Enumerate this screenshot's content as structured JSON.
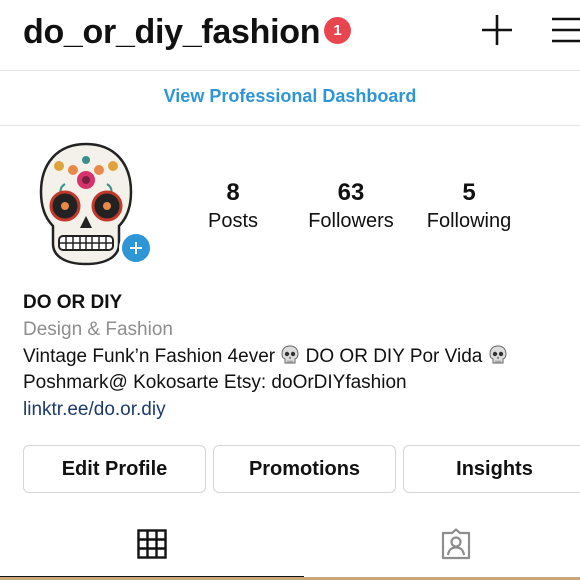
{
  "header": {
    "username": "do_or_diy_fashion",
    "notification_count": "1",
    "new_post_icon": "plus-icon",
    "menu_icon": "hamburger-menu-icon"
  },
  "professional_dashboard": {
    "label": "View Professional Dashboard"
  },
  "profile": {
    "avatar": "sugar-skull-avatar",
    "stats": [
      {
        "value": "8",
        "label": "Posts"
      },
      {
        "value": "63",
        "label": "Followers"
      },
      {
        "value": "5",
        "label": "Following"
      }
    ]
  },
  "bio": {
    "name": "DO OR DIY",
    "category": "Design & Fashion",
    "line1_a": "Vintage Funk’n Fashion 4ever ",
    "line1_b": " DO OR DIY Por Vida ",
    "line2": "Poshmark@ Kokosarte Etsy: doOrDIYfashion",
    "link": "linktr.ee/do.or.diy"
  },
  "buttons": {
    "edit_profile": "Edit Profile",
    "promotions": "Promotions",
    "insights": "Insights"
  },
  "tabs": [
    {
      "icon": "grid-icon",
      "selected": true
    },
    {
      "icon": "tagged-person-icon",
      "selected": false
    }
  ],
  "colors": {
    "accent": "#2f96d6",
    "badge": "#e8454f",
    "link": "#1e3a6c",
    "muted": "#8e8e8e"
  }
}
